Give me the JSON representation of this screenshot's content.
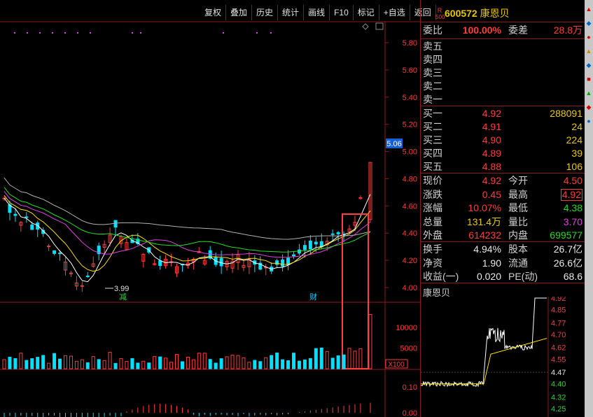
{
  "toolbar": [
    "复权",
    "叠加",
    "历史",
    "统计",
    "画线",
    "F10",
    "标记",
    "+自选",
    "返回"
  ],
  "stock": {
    "badge_top": "R",
    "badge_bottom": "500",
    "code": "600572",
    "name": "康恩贝"
  },
  "weibi": {
    "l1": "委比",
    "v1": "100.00%",
    "l2": "委差",
    "v2": "28.8万"
  },
  "sells": [
    "卖五",
    "卖四",
    "卖三",
    "卖二",
    "卖一"
  ],
  "buys": [
    {
      "label": "买一",
      "price": "4.92",
      "vol": "288091"
    },
    {
      "label": "买二",
      "price": "4.91",
      "vol": "24"
    },
    {
      "label": "买三",
      "price": "4.90",
      "vol": "224"
    },
    {
      "label": "买四",
      "price": "4.89",
      "vol": "39"
    },
    {
      "label": "买五",
      "price": "4.88",
      "vol": "106"
    }
  ],
  "stats1": [
    {
      "l1": "现价",
      "v1": "4.92",
      "l2": "今开",
      "v2": "4.50",
      "c1": "red",
      "c2": "red"
    },
    {
      "l1": "涨跌",
      "v1": "0.45",
      "l2": "最高",
      "v2": "4.92",
      "c1": "red",
      "c2": "red"
    },
    {
      "l1": "涨幅",
      "v1": "10.07%",
      "l2": "最低",
      "v2": "4.38",
      "c1": "red",
      "c2": "grn"
    },
    {
      "l1": "总量",
      "v1": "131.4万",
      "l2": "量比",
      "v2": "3.70",
      "c1": "yel",
      "c2": "mag"
    },
    {
      "l1": "外盘",
      "v1": "614232",
      "l2": "内盘",
      "v2": "699577",
      "c1": "red",
      "c2": "grn"
    }
  ],
  "stats2": [
    {
      "l1": "换手",
      "v1": "4.94%",
      "l2": "股本",
      "v2": "26.7亿"
    },
    {
      "l1": "净资",
      "v1": "1.90",
      "l2": "流通",
      "v2": "26.6亿"
    },
    {
      "l1": "收益(一)",
      "v1": "0.020",
      "l2": "PE(动)",
      "v2": "68.6"
    }
  ],
  "mini": {
    "title": "康恩贝",
    "ticks": [
      "4.92",
      "4.85",
      "4.77",
      "4.70",
      "4.62",
      "4.55",
      "4.47",
      "4.40",
      "4.32",
      "4.25"
    ]
  },
  "main_axis": [
    "5.80",
    "5.60",
    "5.40",
    "5.20",
    "5.00",
    "4.80",
    "4.60",
    "4.40",
    "4.20",
    "4.00"
  ],
  "current_price_tag": "5.06",
  "low_label": "3.99",
  "marker_jian": "减",
  "marker_cai": "财",
  "vol_axis": [
    "10000",
    "5000"
  ],
  "vol_unit": "X100",
  "macd_axis": [
    "0.10",
    "0.00"
  ],
  "colors": {
    "up": "#ff3b3b",
    "down": "#00e0ff",
    "frame": "#8a1a1a"
  }
}
